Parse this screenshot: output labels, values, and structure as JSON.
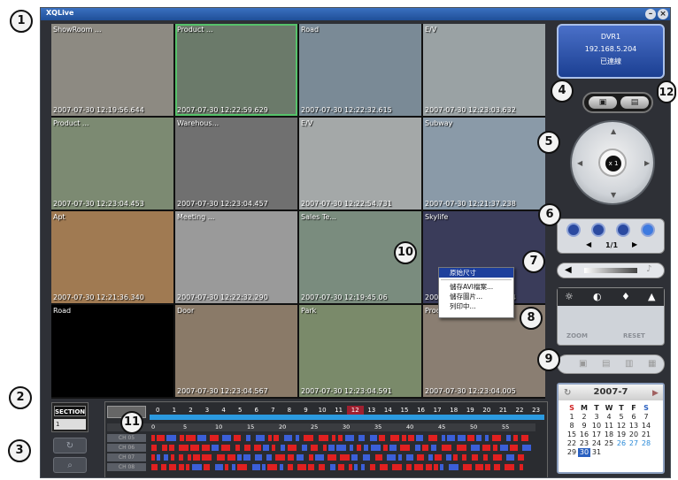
{
  "app": {
    "title": "XQLive"
  },
  "cameras": [
    {
      "name": "ShowRoom ...",
      "ts": "2007-07-30 12:19:56.644",
      "bg": "#8d8a82"
    },
    {
      "name": "Product ...",
      "ts": "2007-07-30 12:22:59.629",
      "bg": "#6b7a6a",
      "selected": true
    },
    {
      "name": "Road",
      "ts": "2007-07-30 12:22:32.615",
      "bg": "#7a8a96"
    },
    {
      "name": "E/V",
      "ts": "2007-07-30 12:23:03.632",
      "bg": "#9aa2a4"
    },
    {
      "name": "Product ...",
      "ts": "2007-07-30 12:23:04.453",
      "bg": "#7c8a72"
    },
    {
      "name": "Warehous...",
      "ts": "2007-07-30 12:23:04.457",
      "bg": "#707070"
    },
    {
      "name": "E/V",
      "ts": "2007-07-30 12:22:54.731",
      "bg": "#a4a8a8"
    },
    {
      "name": "Subway",
      "ts": "2007-07-30 12:21:37.238",
      "bg": "#8a9aa8"
    },
    {
      "name": "Apt",
      "ts": "2007-07-30 12:21:36.340",
      "bg": "#a07a52"
    },
    {
      "name": "Meeting ...",
      "ts": "2007-07-30 12:22:32.290",
      "bg": "#9a9a9a"
    },
    {
      "name": "Sales Te...",
      "ts": "2007-07-30 12:19:45.06",
      "bg": "#7a8c7e"
    },
    {
      "name": "Skylife",
      "ts": "2007-07-30 12:23:04.614",
      "bg": "#3a3c5a"
    },
    {
      "name": "Road",
      "ts": "",
      "bg": "#000000"
    },
    {
      "name": "Door",
      "ts": "2007-07-30 12:23:04.567",
      "bg": "#8a7a68"
    },
    {
      "name": "Park",
      "ts": "2007-07-30 12:23:04.591",
      "bg": "#7a8a6a"
    },
    {
      "name": "Produc...",
      "ts": "2007-07-30 12:23:04.005",
      "bg": "#8a7e72"
    }
  ],
  "context_menu": {
    "items": [
      "原始尺寸",
      "儲存AVI檔案...",
      "儲存圖片...",
      "列印中..."
    ]
  },
  "dvr": {
    "name": "DVR1",
    "ip": "192.168.5.204",
    "status": "已連線"
  },
  "ptz": {
    "zoom": "x 1"
  },
  "layout": {
    "page": "1/1"
  },
  "image_adjust": {
    "zoom_label": "ZOOM",
    "reset_label": "RESET"
  },
  "calendar": {
    "title": "2007-7",
    "weekdays": [
      "S",
      "M",
      "T",
      "W",
      "T",
      "F",
      "S"
    ],
    "weeks": [
      [
        "",
        "",
        "",
        "",
        "",
        "",
        ""
      ],
      [
        "1",
        "2",
        "3",
        "4",
        "5",
        "6",
        "7"
      ],
      [
        "8",
        "9",
        "10",
        "11",
        "12",
        "13",
        "14"
      ],
      [
        "15",
        "16",
        "17",
        "18",
        "19",
        "20",
        "21"
      ],
      [
        "22",
        "23",
        "24",
        "25",
        "26",
        "27",
        "28"
      ],
      [
        "29",
        "30",
        "31",
        "",
        "",
        "",
        ""
      ]
    ],
    "selected_day": "30"
  },
  "section": {
    "label": "SECTION",
    "value": "1"
  },
  "timeline": {
    "hours": [
      "0",
      "1",
      "2",
      "3",
      "4",
      "5",
      "6",
      "7",
      "8",
      "9",
      "10",
      "11",
      "12",
      "13",
      "14",
      "15",
      "16",
      "17",
      "18",
      "19",
      "20",
      "21",
      "22",
      "23"
    ],
    "minutes": [
      "0",
      "5",
      "10",
      "15",
      "20",
      "25",
      "30",
      "35",
      "40",
      "45",
      "50",
      "55"
    ],
    "channels": [
      "CH 05",
      "CH 06",
      "CH 07",
      "CH 08"
    ]
  },
  "callouts": [
    "1",
    "2",
    "3",
    "4",
    "5",
    "6",
    "7",
    "8",
    "9",
    "10",
    "11",
    "12"
  ],
  "colors": {
    "record": "#e02020",
    "motion": "#3b5fd8",
    "accent": "#2b9ae0"
  }
}
